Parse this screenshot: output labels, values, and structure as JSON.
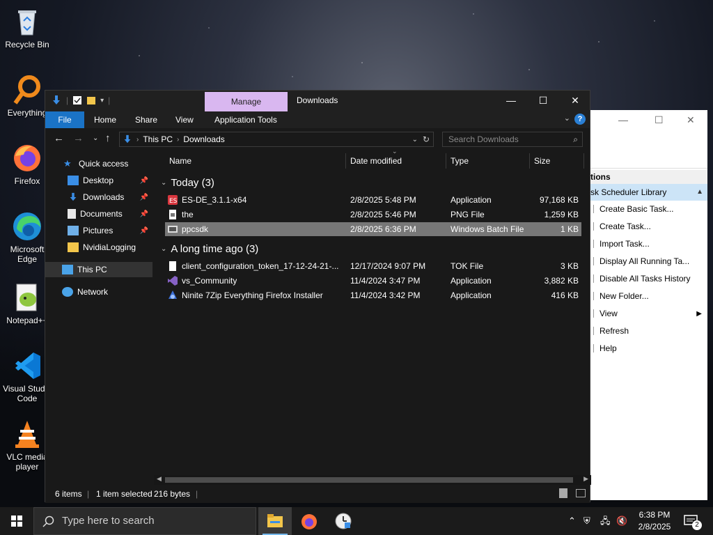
{
  "desktop": {
    "icons": [
      {
        "label": "Recycle Bin"
      },
      {
        "label": "Everything"
      },
      {
        "label": "Firefox"
      },
      {
        "label": "Microsoft Edge"
      },
      {
        "label": "Notepad++"
      },
      {
        "label": "Visual Studio Code"
      },
      {
        "label": "VLC media player"
      }
    ]
  },
  "explorer": {
    "title": "Downloads",
    "manage_tab": "Manage",
    "ribbon_tabs": {
      "file": "File",
      "home": "Home",
      "share": "Share",
      "view": "View",
      "application_tools": "Application Tools"
    },
    "address": {
      "root": "This PC",
      "current": "Downloads"
    },
    "search_placeholder": "Search Downloads",
    "nav": {
      "quick_access": "Quick access",
      "desktop": "Desktop",
      "downloads": "Downloads",
      "documents": "Documents",
      "pictures": "Pictures",
      "nvidialogging": "NvidiaLogging",
      "this_pc": "This PC",
      "network": "Network"
    },
    "columns": {
      "name": "Name",
      "date": "Date modified",
      "type": "Type",
      "size": "Size"
    },
    "groups": [
      {
        "label": "Today (3)",
        "files": [
          {
            "name": "ES-DE_3.1.1-x64",
            "date": "2/8/2025 5:48 PM",
            "type": "Application",
            "size": "97,168 KB"
          },
          {
            "name": "the",
            "date": "2/8/2025 5:46 PM",
            "type": "PNG File",
            "size": "1,259 KB"
          },
          {
            "name": "ppcsdk",
            "date": "2/8/2025 6:36 PM",
            "type": "Windows Batch File",
            "size": "1 KB"
          }
        ]
      },
      {
        "label": "A long time ago (3)",
        "files": [
          {
            "name": "client_configuration_token_17-12-24-21-...",
            "date": "12/17/2024 9:07 PM",
            "type": "TOK File",
            "size": "3 KB"
          },
          {
            "name": "vs_Community",
            "date": "11/4/2024 3:47 PM",
            "type": "Application",
            "size": "3,882 KB"
          },
          {
            "name": "Ninite 7Zip Everything Firefox Installer",
            "date": "11/4/2024 3:42 PM",
            "type": "Application",
            "size": "416 KB"
          }
        ]
      }
    ],
    "status": {
      "items": "6 items",
      "selected": "1 item selected",
      "size": "216 bytes"
    }
  },
  "task_scheduler": {
    "actions_header": "tions",
    "library": "sk Scheduler Library",
    "items": [
      "Create Basic Task...",
      "Create Task...",
      "Import Task...",
      "Display All Running Ta...",
      "Disable All Tasks History",
      "New Folder...",
      "View",
      "Refresh",
      "Help"
    ]
  },
  "taskbar": {
    "search_placeholder": "Type here to search",
    "time": "6:38 PM",
    "date": "2/8/2025",
    "notification_count": "2"
  },
  "colors": {
    "accent": "#1a73c6",
    "manage": "#d9b7f0",
    "selection": "#777777",
    "task_sel": "#cce4f7"
  }
}
